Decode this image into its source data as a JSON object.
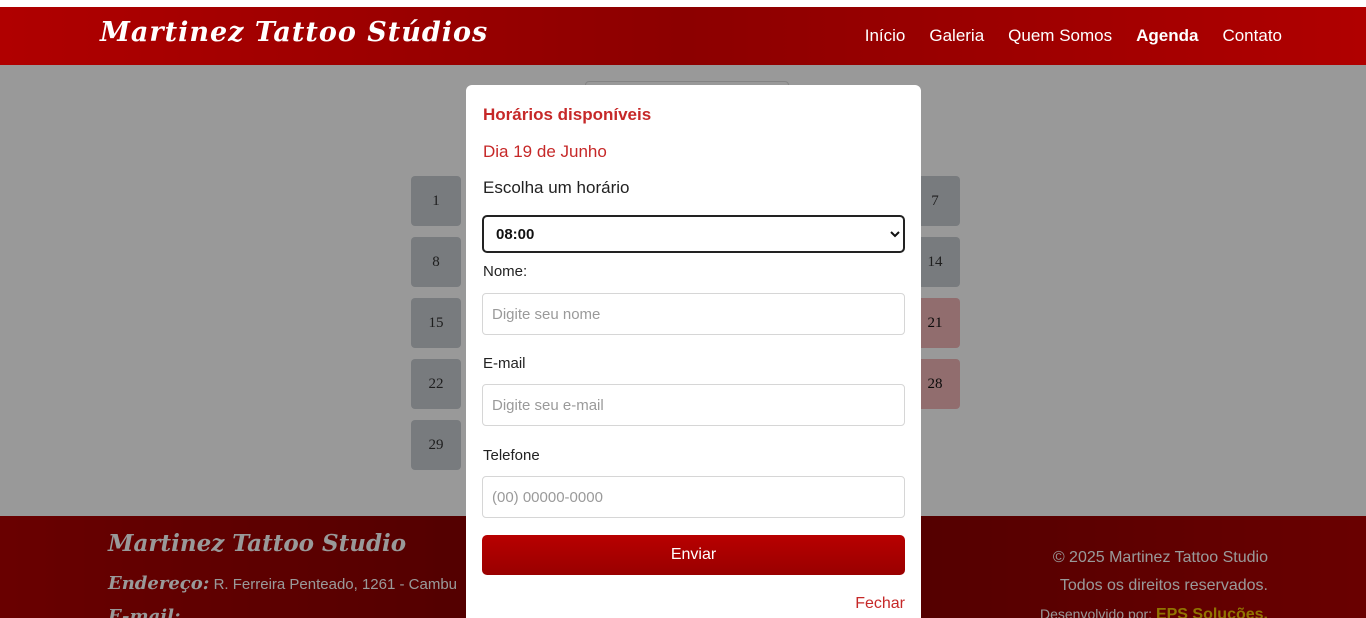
{
  "header": {
    "logo": "Martinez Tattoo Stúdios",
    "nav": [
      "Início",
      "Galeria",
      "Quem Somos",
      "Agenda",
      "Contato"
    ],
    "active_nav": "Agenda"
  },
  "calendar": {
    "days_left": [
      "1",
      "8",
      "15",
      "22",
      "29"
    ],
    "days_right": [
      "7",
      "14",
      "21",
      "28"
    ],
    "busy_days": [
      "21",
      "28"
    ]
  },
  "footer": {
    "brand": "Martinez Tattoo Studio",
    "address_label": "Endereço:",
    "address": "R. Ferreira Penteado, 1261 - Cambu",
    "email_label": "E-mail:",
    "copyright": "© 2025 Martinez Tattoo Studio",
    "rights": "Todos os direitos reservados.",
    "dev_label": "Desenvolvido por:",
    "dev_name": "EPS Soluções."
  },
  "modal": {
    "title": "Horários disponíveis",
    "date": "Dia 19 de Junho",
    "choose_label": "Escolha um horário",
    "time_selected": "08:00",
    "name_label": "Nome:",
    "name_placeholder": "Digite seu nome",
    "email_label": "E-mail",
    "email_placeholder": "Digite seu e-mail",
    "phone_label": "Telefone",
    "phone_placeholder": "(00) 00000-0000",
    "submit": "Enviar",
    "close": "Fechar"
  },
  "colors": {
    "brand_red": "#a00000",
    "accent_text": "#c62828",
    "footer_highlight": "#f0c000"
  }
}
